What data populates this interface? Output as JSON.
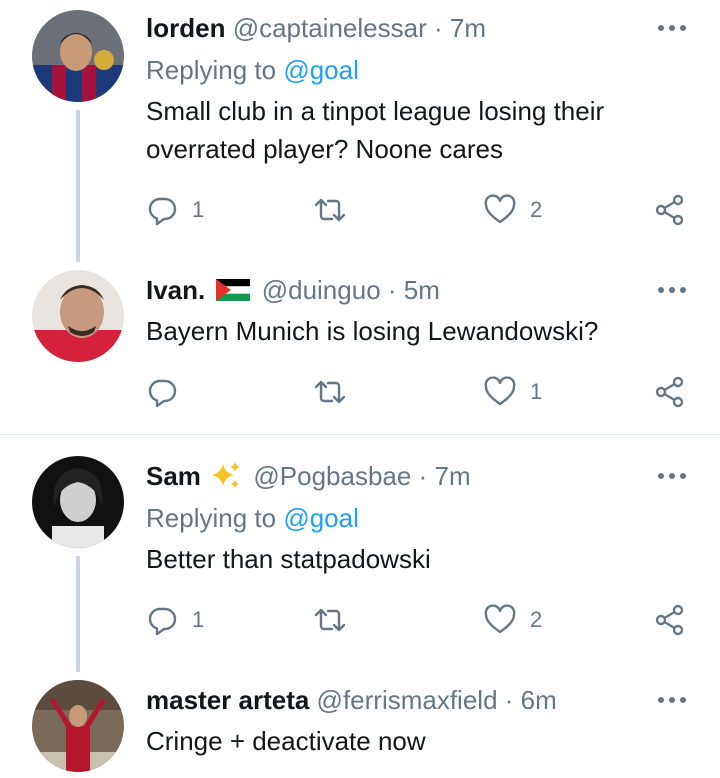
{
  "tweets": [
    {
      "name": "lorden",
      "handle": "@captainelessar",
      "dot": "·",
      "time": "7m",
      "replying_prefix": "Replying to",
      "replying_to": "@goal",
      "text": "Small club in a tinpot league losing their overrated player? Noone cares",
      "reply_count": "1",
      "retweet_count": "",
      "like_count": "2"
    },
    {
      "name": "Ivan.",
      "handle": "@duinguo",
      "dot": "·",
      "time": "5m",
      "text": "Bayern Munich is losing Lewandowski?",
      "reply_count": "",
      "retweet_count": "",
      "like_count": "1"
    },
    {
      "name": "Sam",
      "handle": "@Pogbasbae",
      "dot": "·",
      "time": "7m",
      "replying_prefix": "Replying to",
      "replying_to": "@goal",
      "text": "Better than statpadowski",
      "reply_count": "1",
      "retweet_count": "",
      "like_count": "2"
    },
    {
      "name": "master arteta",
      "handle": "@ferrismaxfield",
      "dot": "·",
      "time": "6m",
      "text": "Cringe + deactivate now"
    }
  ],
  "icons": {
    "reply": "reply-icon",
    "retweet": "retweet-icon",
    "like": "heart-icon",
    "share": "share-icon",
    "more": "more-options-icon",
    "flag": "palestine-flag-icon",
    "sparkle": "sparkles-icon"
  },
  "colors": {
    "text": "#14171a",
    "secondary": "#657786",
    "accent": "#1da1f2",
    "thread_line": "#ccd6dd"
  }
}
